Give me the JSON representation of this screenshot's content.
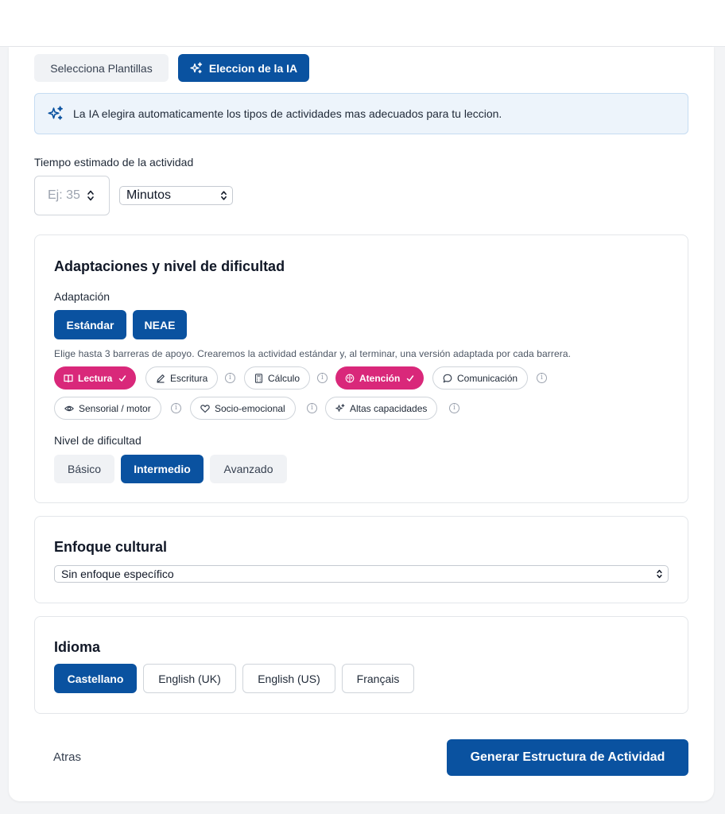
{
  "mode_tabs": {
    "templates_label": "Selecciona Plantillas",
    "ai_label": "Eleccion de la IA"
  },
  "ai_banner": {
    "text": "La IA elegira automaticamente los tipos de actividades mas adecuados para tu leccion.",
    "icon": "sparkles-icon"
  },
  "time": {
    "label": "Tiempo estimado de la actividad",
    "placeholder": "Ej: 35",
    "unit_selected": "Minutos"
  },
  "adaptations": {
    "title": "Adaptaciones y nivel de dificultad",
    "adaptation_label": "Adaptación",
    "adaptation_options": [
      "Estándar",
      "NEAE"
    ],
    "hint": "Elige hasta 3 barreras de apoyo. Crearemos la actividad estándar y, al terminar, una versión adaptada por cada barrera.",
    "barriers": [
      {
        "label": "Lectura",
        "selected": true,
        "icon": "book-icon"
      },
      {
        "label": "Escritura",
        "selected": false,
        "icon": "pencil-icon"
      },
      {
        "label": "Cálculo",
        "selected": false,
        "icon": "calculator-icon"
      },
      {
        "label": "Atención",
        "selected": true,
        "icon": "brain-icon"
      },
      {
        "label": "Comunicación",
        "selected": false,
        "icon": "chat-bubble-icon"
      },
      {
        "label": "Sensorial / motor",
        "selected": false,
        "icon": "eye-icon"
      },
      {
        "label": "Socio-emocional",
        "selected": false,
        "icon": "heart-icon"
      },
      {
        "label": "Altas capacidades",
        "selected": false,
        "icon": "sparkles-icon"
      }
    ],
    "info_glyph": "i",
    "difficulty_label": "Nivel de dificultad",
    "difficulty_options": [
      "Básico",
      "Intermedio",
      "Avanzado"
    ],
    "difficulty_selected": "Intermedio"
  },
  "culture": {
    "title": "Enfoque cultural",
    "selected": "Sin enfoque específico"
  },
  "language": {
    "title": "Idioma",
    "options": [
      "Castellano",
      "English (UK)",
      "English (US)",
      "Français"
    ],
    "selected": "Castellano"
  },
  "footer": {
    "back_label": "Atras",
    "generate_label": "Generar Estructura de Actividad"
  },
  "colors": {
    "primary": "#0a52a0",
    "chip_selected": "#d9287a",
    "banner_bg": "#edf4fb"
  }
}
